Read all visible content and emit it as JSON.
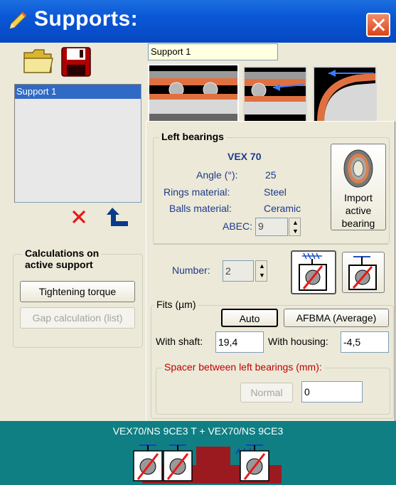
{
  "window": {
    "title": "Supports:"
  },
  "toolbar": {
    "open_icon": "folder-icon",
    "save_icon": "floppy-disk-icon"
  },
  "supports_list": {
    "items": [
      "Support 1"
    ]
  },
  "list_actions": {
    "delete_icon": "red-x-icon",
    "move_up_icon": "up-arrow-icon"
  },
  "calculations": {
    "title_line1": "Calculations on",
    "title_line2": "active support",
    "tightening_torque": "Tightening torque",
    "gap_calculation": "Gap calculation (list)"
  },
  "support_name": "Support 1",
  "bearing_tabs": [
    "left-bearings-tab",
    "axial-force-tab",
    "right-bearings-tab"
  ],
  "left_bearings": {
    "title": "Left bearings",
    "model": "VEX 70",
    "angle_label": "Angle (°):",
    "angle_value": "25",
    "rings_label": "Rings material:",
    "rings_value": "Steel",
    "balls_label": "Balls material:",
    "balls_value": "Ceramic",
    "abec_label": "ABEC:",
    "abec_value": "9",
    "import_line1": "Import",
    "import_line2": "active",
    "import_line3": "bearing",
    "number_label": "Number:",
    "number_value": "2"
  },
  "fits": {
    "title": "Fits (µm)",
    "auto": "Auto",
    "afbma": "AFBMA (Average)",
    "shaft_label": "With shaft:",
    "shaft_value": "19,4",
    "housing_label": "With housing:",
    "housing_value": "-4,5"
  },
  "spacer": {
    "title": "Spacer between left bearings (mm):",
    "normal": "Normal",
    "value": "0"
  },
  "assembly": {
    "label": "VEX70/NS 9CE3 T + VEX70/NS 9CE3"
  },
  "colors": {
    "title_blue": "#0a57d6",
    "selection": "#316ac5",
    "teal": "#0f7f84",
    "label_blue": "#1c3a8c"
  }
}
